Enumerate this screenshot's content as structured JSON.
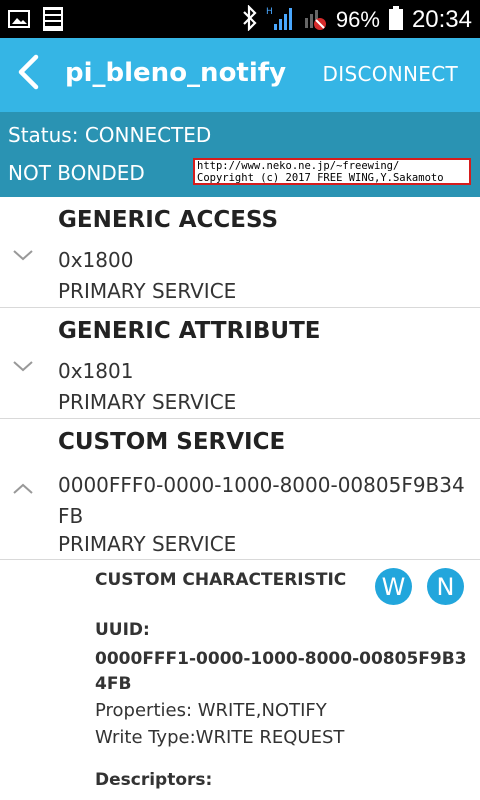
{
  "status_bar": {
    "battery": "96%",
    "time": "20:34",
    "icons": [
      "image-icon",
      "lock-screen-icon",
      "bluetooth-icon",
      "signal-icon",
      "no-sim-icon",
      "battery-icon"
    ]
  },
  "app_bar": {
    "title": "pi_bleno_notify",
    "action": "DISCONNECT"
  },
  "status_panel": {
    "status": "Status: CONNECTED",
    "bond": "NOT BONDED",
    "watermark_line1": "http://www.neko.ne.jp/~freewing/",
    "watermark_line2": "Copyright (c) 2017 FREE WING,Y.Sakamoto"
  },
  "services": [
    {
      "name": "GENERIC ACCESS",
      "uuid": "0x1800",
      "type": "PRIMARY SERVICE",
      "expanded": false
    },
    {
      "name": "GENERIC ATTRIBUTE",
      "uuid": "0x1801",
      "type": "PRIMARY SERVICE",
      "expanded": false
    },
    {
      "name": "CUSTOM SERVICE",
      "uuid": "0000FFF0-0000-1000-8000-00805F9B34FB",
      "type": "PRIMARY SERVICE",
      "expanded": true
    }
  ],
  "characteristic": {
    "name": "CUSTOM CHARACTERISTIC",
    "write_button": "W",
    "notify_button": "N",
    "uuid_label": "UUID:",
    "uuid": "0000FFF1-0000-1000-8000-00805F9B34FB",
    "properties": "Properties: WRITE,NOTIFY",
    "write_type": "Write Type:WRITE REQUEST",
    "descriptors_label": "Descriptors:"
  },
  "colors": {
    "app_bar": "#35b5e5",
    "status_panel": "#2a93b3",
    "action_circle": "#22a6dc"
  }
}
